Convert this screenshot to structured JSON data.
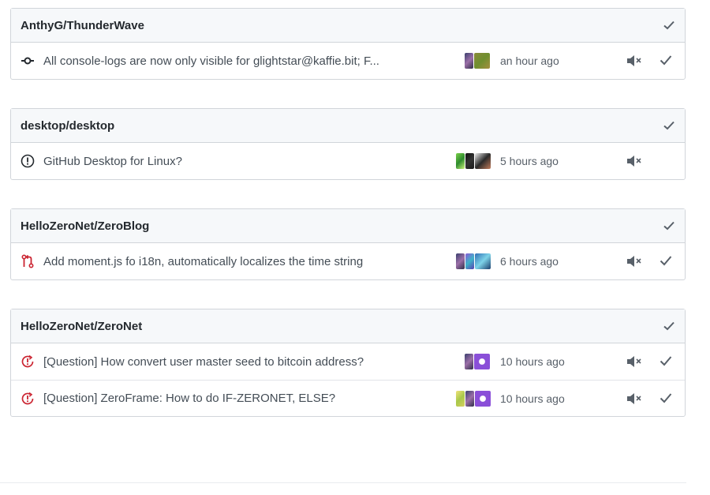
{
  "repos": [
    {
      "name": "AnthyG/ThunderWave",
      "items": [
        {
          "type": "commit-icon",
          "title": "All console-logs are now only visible for glightstar@kaffie.bit; F...",
          "time": "an hour ago",
          "has_done": true
        }
      ]
    },
    {
      "name": "desktop/desktop",
      "items": [
        {
          "type": "issue-opened-icon",
          "title": "GitHub Desktop for Linux?",
          "time": "5 hours ago",
          "has_done": false
        }
      ]
    },
    {
      "name": "HelloZeroNet/ZeroBlog",
      "items": [
        {
          "type": "pull-request-icon",
          "title": "Add moment.js fo i18n, automatically localizes the time string",
          "time": "6 hours ago",
          "has_done": true
        }
      ]
    },
    {
      "name": "HelloZeroNet/ZeroNet",
      "items": [
        {
          "type": "issue-reopened-icon",
          "title": "[Question] How convert user master seed to bitcoin address?",
          "time": "10 hours ago",
          "has_done": true
        },
        {
          "type": "issue-reopened-icon",
          "title": "[Question] ZeroFrame: How to do IF-ZERONET, ELSE?",
          "time": "10 hours ago",
          "has_done": true
        }
      ]
    }
  ],
  "colors": {
    "icon_default": "#24292e",
    "icon_red": "#cb2431",
    "border": "#d1d5da",
    "header_bg": "#f6f8fa"
  }
}
